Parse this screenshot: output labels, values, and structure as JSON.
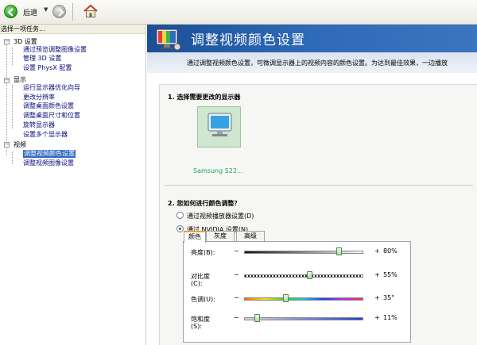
{
  "toolbar": {
    "back_label": "后退",
    "back_drop": "▼"
  },
  "left_pane": {
    "header": "选择一项任务...",
    "categories": [
      {
        "label": "3D 设置",
        "items": [
          "通过预览调整图像设置",
          "管理 3D 设置",
          "设置 PhysX 配置"
        ]
      },
      {
        "label": "显示",
        "items": [
          "运行显示器优化向导",
          "更改分辨率",
          "调整桌面颜色设置",
          "调整桌面尺寸和位置",
          "旋转显示器",
          "设置多个显示器"
        ]
      },
      {
        "label": "视频",
        "items": [
          "调整视频颜色设置",
          "调整视频图像设置"
        ]
      }
    ]
  },
  "right_pane": {
    "title": "调整视频颜色设置",
    "description": "通过调整视频颜色设置，可微调显示器上的视频内容的颜色设置。为达到最佳效果，一边播放",
    "section1_title": "1. 选择需要更改的显示器",
    "display_name": "Samsung S22...",
    "section2_title": "2. 您如何进行颜色调整？",
    "radio_player": "通过视频播放器设置(D)",
    "radio_nvidia": "通过 NVIDIA 设置(N)",
    "tabs": [
      "颜色",
      "灰度",
      "高级"
    ],
    "sliders": [
      {
        "label": "亮度(B):",
        "value_text": "80%",
        "value": 80
      },
      {
        "label": "对比度",
        "label2": "(C):",
        "value_text": "55%",
        "value": 55
      },
      {
        "label": "色调(U):",
        "value_text": "35°",
        "value": 35
      },
      {
        "label": "饱和度",
        "label2": "(S):",
        "value_text": "11%",
        "value": 11
      }
    ]
  }
}
